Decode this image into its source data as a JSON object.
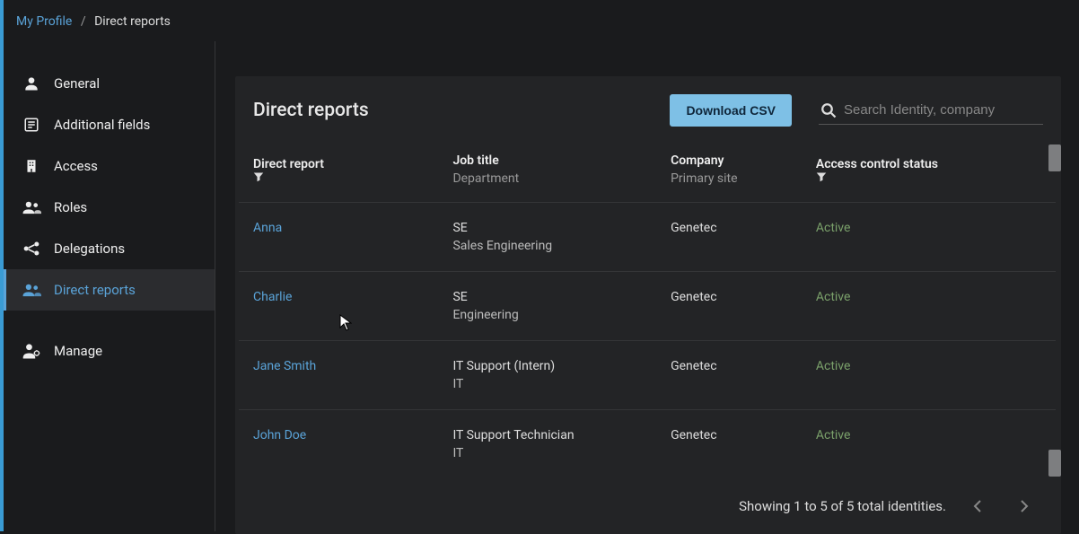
{
  "breadcrumb": {
    "root": "My Profile",
    "current": "Direct reports"
  },
  "sidebar": {
    "items": [
      {
        "label": "General",
        "icon": "person-icon"
      },
      {
        "label": "Additional fields",
        "icon": "form-icon"
      },
      {
        "label": "Access",
        "icon": "building-icon"
      },
      {
        "label": "Roles",
        "icon": "group-icon"
      },
      {
        "label": "Delegations",
        "icon": "share-icon"
      },
      {
        "label": "Direct reports",
        "icon": "group-icon"
      }
    ],
    "manage": {
      "label": "Manage",
      "icon": "person-gear-icon"
    }
  },
  "panel": {
    "title": "Direct reports",
    "download_label": "Download CSV",
    "search_placeholder": "Search Identity, company"
  },
  "table": {
    "headers": {
      "direct_report": "Direct report",
      "job_title": "Job title",
      "department": "Department",
      "company": "Company",
      "primary_site": "Primary site",
      "access_status": "Access control status"
    },
    "rows": [
      {
        "name": "Anna",
        "job": "SE",
        "dept": "Sales Engineering",
        "company": "Genetec",
        "site": "",
        "status": "Active"
      },
      {
        "name": "Charlie",
        "job": "SE",
        "dept": "Engineering",
        "company": "Genetec",
        "site": "",
        "status": "Active"
      },
      {
        "name": "Jane Smith",
        "job": "IT Support (Intern)",
        "dept": "IT",
        "company": "Genetec",
        "site": "",
        "status": "Active"
      },
      {
        "name": "John Doe",
        "job": "IT Support Technician",
        "dept": "IT",
        "company": "Genetec",
        "site": "",
        "status": "Active"
      }
    ]
  },
  "footer": {
    "summary": "Showing 1 to 5 of 5 total identities."
  }
}
